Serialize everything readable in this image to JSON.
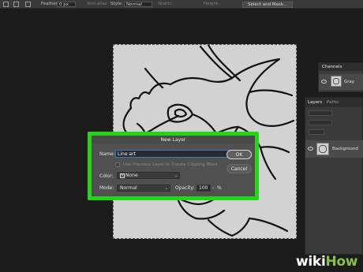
{
  "options_bar": {
    "feather_label": "Feather:",
    "feather_value": "0 px",
    "anti_alias_label": "Anti-alias",
    "style_label": "Style:",
    "style_value": "Normal",
    "width_label": "Width:",
    "height_label": "Height:",
    "select_mask_label": "Select and Mask..."
  },
  "channels_panel": {
    "tab_label": "Channels",
    "channel_name": "Gray"
  },
  "layers_panel": {
    "tab_layers": "Layers",
    "tab_paths": "Paths",
    "layer_name": "Background"
  },
  "dialog": {
    "title": "New Layer",
    "name_label": "Name:",
    "name_value": "Line art",
    "clipping_mask_label": "Use Previous Layer to Create Clipping Mask",
    "color_label": "Color:",
    "color_value": "None",
    "mode_label": "Mode:",
    "mode_value": "Normal",
    "opacity_label": "Opacity:",
    "opacity_value": "100",
    "opacity_unit": "%",
    "ok_label": "OK",
    "cancel_label": "Cancel"
  },
  "watermark": {
    "prefix": "wiki",
    "suffix": "How"
  },
  "colors": {
    "highlight": "#22d617",
    "app_bg": "#1c1c1c",
    "dialog_bg": "#505050",
    "canvas_bg": "#d2d2d2"
  }
}
